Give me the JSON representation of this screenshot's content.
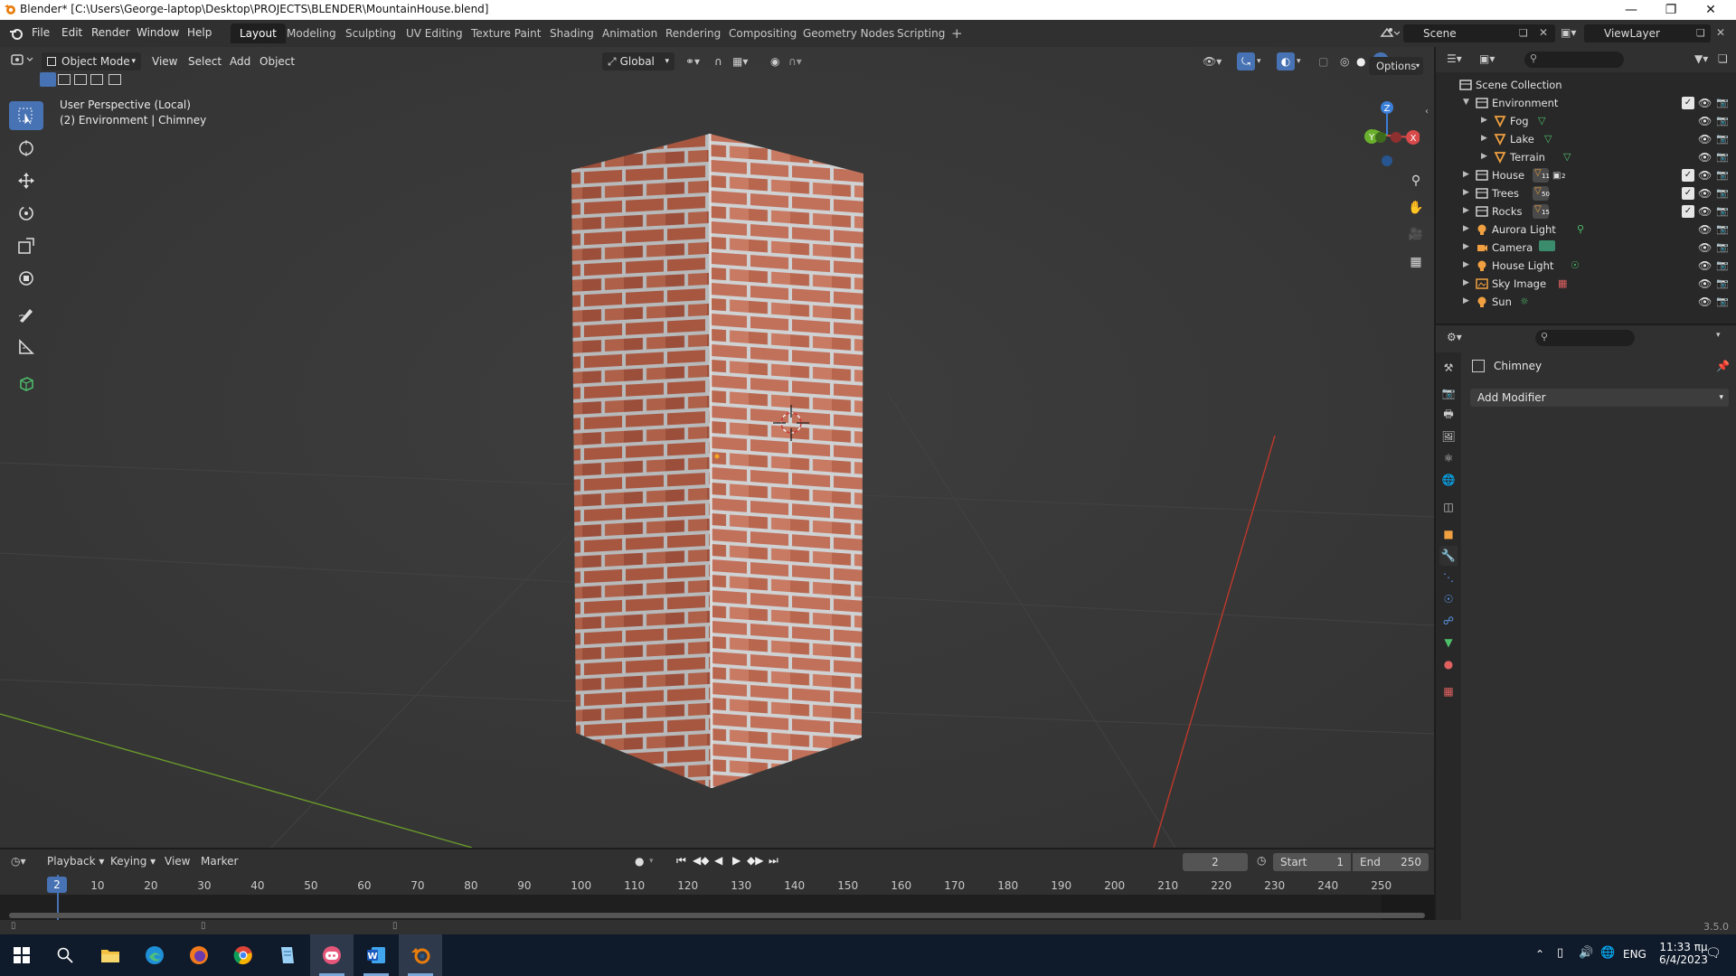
{
  "window": {
    "title": "Blender* [C:\\Users\\George-laptop\\Desktop\\PROJECTS\\BLENDER\\MountainHouse.blend]"
  },
  "menu": [
    "File",
    "Edit",
    "Render",
    "Window",
    "Help"
  ],
  "workspaces": [
    "Layout",
    "Modeling",
    "Sculpting",
    "UV Editing",
    "Texture Paint",
    "Shading",
    "Animation",
    "Rendering",
    "Compositing",
    "Geometry Nodes",
    "Scripting"
  ],
  "active_workspace": "Layout",
  "scene": {
    "name": "Scene",
    "view_layer": "ViewLayer"
  },
  "viewport": {
    "mode": "Object Mode",
    "menus": [
      "View",
      "Select",
      "Add",
      "Object"
    ],
    "transform_orientation": "Global",
    "options_label": "Options",
    "info_line1": "User Perspective (Local)",
    "info_line2": "(2) Environment | Chimney",
    "gizmo": {
      "x": "X",
      "y": "Y",
      "z": "Z"
    }
  },
  "outliner": {
    "root": "Scene Collection",
    "items": [
      {
        "label": "Environment",
        "icon": "collection-icon",
        "badge": ""
      },
      {
        "label": "Fog",
        "icon": "mesh-object-icon",
        "badge": ""
      },
      {
        "label": "Lake",
        "icon": "mesh-object-icon",
        "badge": ""
      },
      {
        "label": "Terrain",
        "icon": "mesh-object-icon",
        "badge": ""
      },
      {
        "label": "House",
        "icon": "collection-icon",
        "badge": "11",
        "badge2": "2"
      },
      {
        "label": "Trees",
        "icon": "collection-icon",
        "badge": "50"
      },
      {
        "label": "Rocks",
        "icon": "collection-icon",
        "badge": "15"
      },
      {
        "label": "Aurora Light",
        "icon": "light-icon",
        "badge": ""
      },
      {
        "label": "Camera",
        "icon": "camera-icon",
        "badge": ""
      },
      {
        "label": "House Light",
        "icon": "light-icon",
        "badge": ""
      },
      {
        "label": "Sky Image",
        "icon": "image-icon",
        "badge": ""
      },
      {
        "label": "Sun",
        "icon": "light-icon",
        "badge": ""
      }
    ]
  },
  "properties": {
    "object_name": "Chimney",
    "add_modifier": "Add Modifier"
  },
  "timeline": {
    "menus": [
      "Playback",
      "Keying",
      "View",
      "Marker"
    ],
    "current_frame": "2",
    "start_label": "Start",
    "start": "1",
    "end_label": "End",
    "end": "250",
    "ticks": [
      "2",
      "10",
      "20",
      "30",
      "40",
      "50",
      "60",
      "70",
      "80",
      "90",
      "100",
      "110",
      "120",
      "130",
      "140",
      "150",
      "160",
      "170",
      "180",
      "190",
      "200",
      "210",
      "220",
      "230",
      "240",
      "250"
    ]
  },
  "status": {
    "version": "3.5.0"
  },
  "taskbar": {
    "language": "ENG",
    "time": "11:33 πμ",
    "date": "6/4/2023"
  },
  "colors": {
    "accent": "#4772b3",
    "brick": "#b0604a",
    "mortar": "#c7c9cb",
    "viewport_bg": "#393939",
    "axis_x": "#c0392b",
    "axis_y": "#6a9a2a"
  }
}
